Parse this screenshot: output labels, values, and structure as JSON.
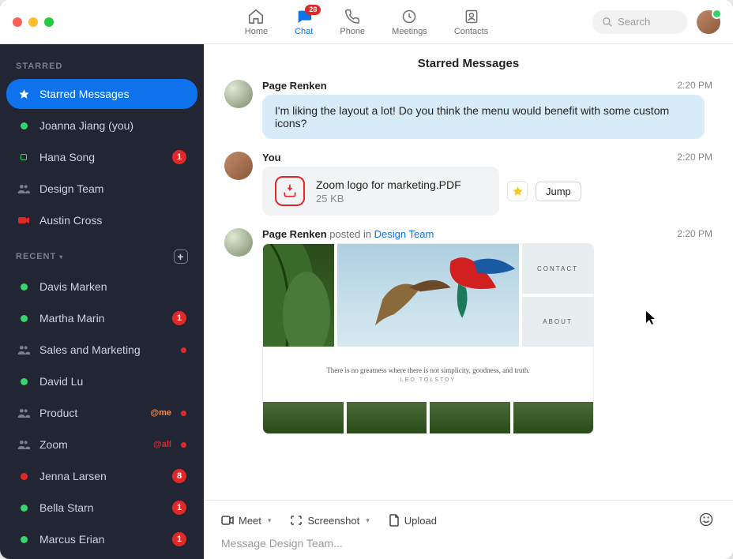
{
  "nav": {
    "home": "Home",
    "chat": "Chat",
    "chat_badge": "28",
    "phone": "Phone",
    "meetings": "Meetings",
    "contacts": "Contacts"
  },
  "search": {
    "placeholder": "Search"
  },
  "sidebar": {
    "starred_label": "STARRED",
    "recent_label": "RECENT",
    "starred": [
      {
        "name": "Starred Messages",
        "type": "star",
        "selected": true
      },
      {
        "name": "Joanna Jiang (you)",
        "type": "green"
      },
      {
        "name": "Hana Song",
        "type": "hollow",
        "badge": "1"
      },
      {
        "name": "Design Team",
        "type": "group"
      },
      {
        "name": "Austin Cross",
        "type": "red"
      }
    ],
    "recent": [
      {
        "name": "Davis Marken",
        "type": "green"
      },
      {
        "name": "Martha Marin",
        "type": "green",
        "badge": "1"
      },
      {
        "name": "Sales and Marketing",
        "type": "group",
        "dot": true
      },
      {
        "name": "David Lu",
        "type": "green"
      },
      {
        "name": "Product",
        "type": "group",
        "mention": "@me",
        "dot": true
      },
      {
        "name": "Zoom",
        "type": "group",
        "mention": "@all",
        "dot": true
      },
      {
        "name": "Jenna Larsen",
        "type": "red",
        "badge": "8"
      },
      {
        "name": "Bella Starn",
        "type": "green",
        "badge": "1"
      },
      {
        "name": "Marcus Erian",
        "type": "green",
        "badge": "1"
      }
    ]
  },
  "main": {
    "title": "Starred Messages"
  },
  "messages": {
    "m1": {
      "author": "Page Renken",
      "time": "2:20 PM",
      "text": "I'm liking the layout a lot! Do you think the menu would benefit with some custom icons?"
    },
    "m2": {
      "author": "You",
      "time": "2:20 PM",
      "file_name": "Zoom logo for marketing.PDF",
      "file_size": "25 KB",
      "jump": "Jump"
    },
    "m3": {
      "author": "Page Renken",
      "posted_in": " posted in ",
      "channel": "Design Team",
      "time": "2:20 PM",
      "preview": {
        "chip1": "CONTACT",
        "chip2": "ABOUT",
        "quote": "There is no greatness where there is not simplicity, goodness, and truth.",
        "quote_author": "LEO TOLSTOY"
      }
    }
  },
  "composer": {
    "meet": "Meet",
    "screenshot": "Screenshot",
    "upload": "Upload",
    "placeholder": "Message Design Team..."
  }
}
